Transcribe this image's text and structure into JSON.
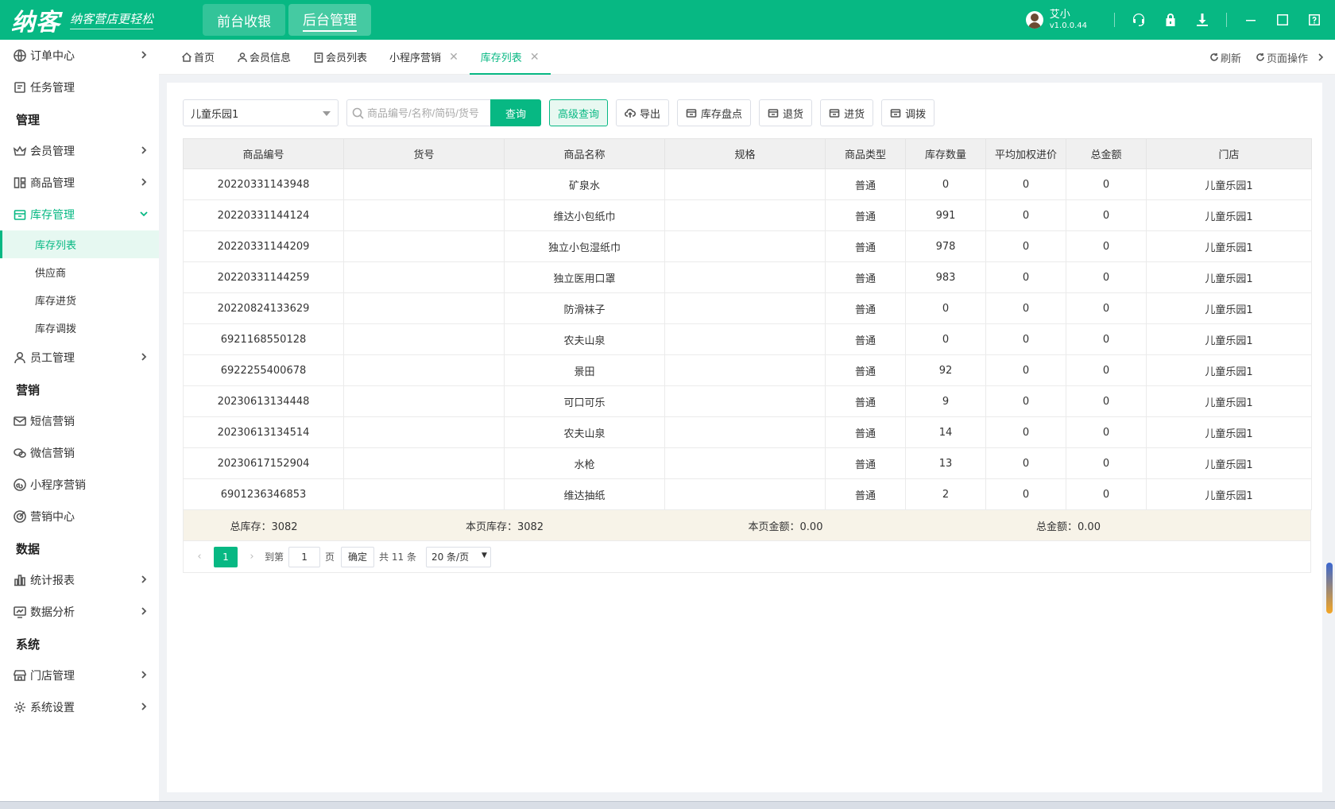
{
  "app": {
    "logo": "纳客",
    "slogan": "纳客营店更轻松",
    "top_nav": [
      "前台收银",
      "后台管理"
    ],
    "user": {
      "name": "艾小",
      "version": "v1.0.0.44"
    }
  },
  "sidebar": {
    "items": [
      {
        "label": "订单中心",
        "icon": "globe-icon",
        "chev": true
      },
      {
        "label": "任务管理",
        "icon": "task-icon",
        "chev": false
      }
    ],
    "groups": {
      "manage": "管理",
      "marketing": "营销",
      "data": "数据",
      "system": "系统"
    },
    "manage_items": [
      {
        "label": "会员管理",
        "icon": "crown-icon"
      },
      {
        "label": "商品管理",
        "icon": "grid-icon"
      }
    ],
    "stock": {
      "label": "库存管理",
      "subs": [
        "库存列表",
        "供应商",
        "库存进货",
        "库存调拨"
      ]
    },
    "staff": "员工管理",
    "marketing_items": [
      "短信营销",
      "微信营销",
      "小程序营销",
      "营销中心"
    ],
    "data_items": [
      "统计报表",
      "数据分析"
    ],
    "system_items": [
      "门店管理",
      "系统设置"
    ]
  },
  "tabs": {
    "items": [
      "首页",
      "会员信息",
      "会员列表",
      "小程序营销",
      "库存列表"
    ],
    "refresh": "刷新",
    "page_ops": "页面操作"
  },
  "toolbar": {
    "store": "儿童乐园1",
    "search_placeholder": "商品编号/名称/简码/货号",
    "query": "查询",
    "advanced": "高级查询",
    "export": "导出",
    "stocktake": "库存盘点",
    "return": "退货",
    "purchase": "进货",
    "transfer": "调拨"
  },
  "table": {
    "headers": [
      "商品编号",
      "货号",
      "商品名称",
      "规格",
      "商品类型",
      "库存数量",
      "平均加权进价",
      "总金额",
      "门店"
    ],
    "rows": [
      [
        "20220331143948",
        "",
        "矿泉水",
        "",
        "普通",
        "0",
        "0",
        "0",
        "儿童乐园1"
      ],
      [
        "20220331144124",
        "",
        "维达小包纸巾",
        "",
        "普通",
        "991",
        "0",
        "0",
        "儿童乐园1"
      ],
      [
        "20220331144209",
        "",
        "独立小包湿纸巾",
        "",
        "普通",
        "978",
        "0",
        "0",
        "儿童乐园1"
      ],
      [
        "20220331144259",
        "",
        "独立医用口罩",
        "",
        "普通",
        "983",
        "0",
        "0",
        "儿童乐园1"
      ],
      [
        "20220824133629",
        "",
        "防滑袜子",
        "",
        "普通",
        "0",
        "0",
        "0",
        "儿童乐园1"
      ],
      [
        "6921168550128",
        "",
        "农夫山泉",
        "",
        "普通",
        "0",
        "0",
        "0",
        "儿童乐园1"
      ],
      [
        "6922255400678",
        "",
        "景田",
        "",
        "普通",
        "92",
        "0",
        "0",
        "儿童乐园1"
      ],
      [
        "20230613134448",
        "",
        "可口可乐",
        "",
        "普通",
        "9",
        "0",
        "0",
        "儿童乐园1"
      ],
      [
        "20230613134514",
        "",
        "农夫山泉",
        "",
        "普通",
        "14",
        "0",
        "0",
        "儿童乐园1"
      ],
      [
        "20230617152904",
        "",
        "水枪",
        "",
        "普通",
        "13",
        "0",
        "0",
        "儿童乐园1"
      ],
      [
        "6901236346853",
        "",
        "维达抽纸",
        "",
        "普通",
        "2",
        "0",
        "0",
        "儿童乐园1"
      ]
    ],
    "summary": {
      "total_stock": "总库存：3082",
      "page_stock": "本页库存：3082",
      "page_amount": "本页金额：0.00",
      "total_amount": "总金额：0.00"
    }
  },
  "pager": {
    "current": "1",
    "goto": "到第",
    "page_input": "1",
    "page_unit": "页",
    "confirm": "确定",
    "total": "共 11 条",
    "size": "20 条/页"
  },
  "colors": {
    "brand": "#07b883",
    "summary_bg": "#f7f3e8"
  }
}
